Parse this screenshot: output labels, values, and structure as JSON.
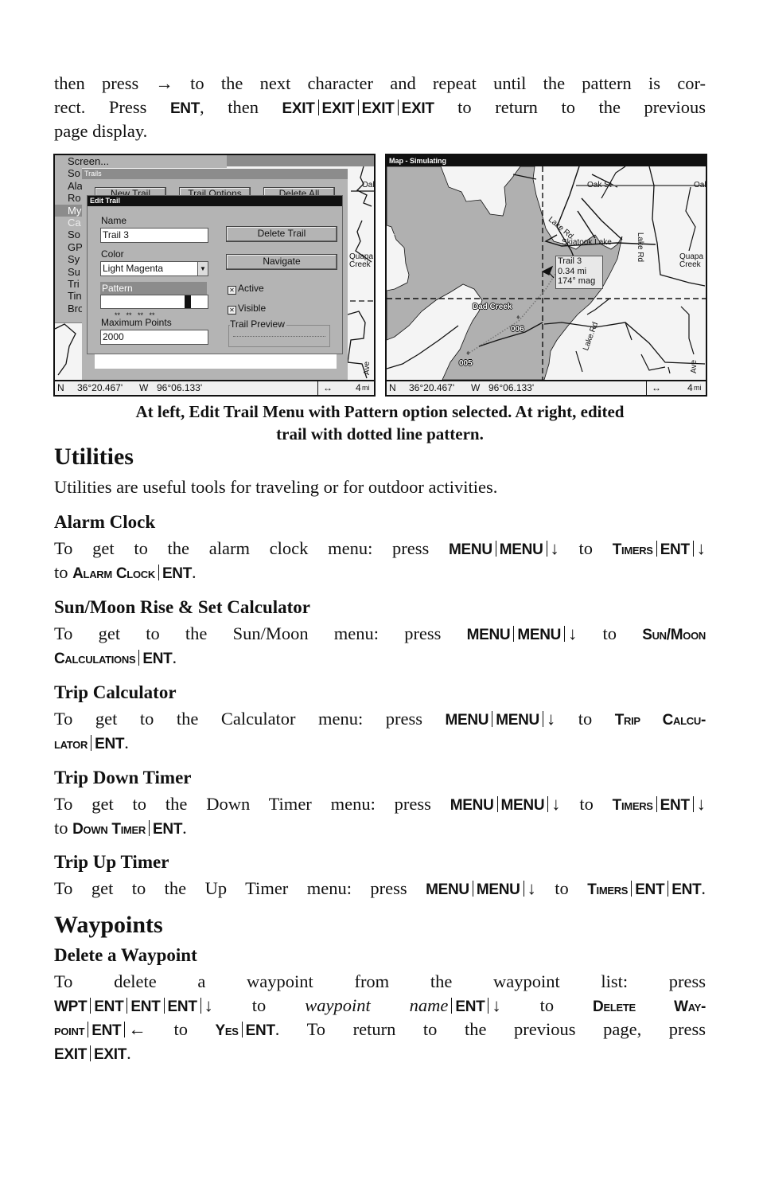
{
  "intro": {
    "line1": "then press → to the next character and repeat until the pattern is cor-",
    "line2_a": "rect. Press",
    "line2_ent": "ENT",
    "line2_b": ", then",
    "exit": "EXIT",
    "line2_c": "to return to the previous",
    "line3": "page display."
  },
  "left_screen": {
    "menu_items": [
      "Screen...",
      "So",
      "Ala",
      "Ro",
      "My",
      "Ca",
      "So",
      "GP",
      "Sy",
      "Su",
      "Tri",
      "Tin",
      "Bro"
    ],
    "selected_menu_index": 4,
    "trails_title": "Trails",
    "trails_buttons": [
      "New Trail",
      "Trail Options",
      "Delete All"
    ],
    "edit_title": "Edit Trail",
    "name_label": "Name",
    "name_value": "Trail 3",
    "color_label": "Color",
    "color_value": "Light Magenta",
    "pattern_label": "Pattern",
    "pattern_value": "**   **   **   **",
    "max_points_label": "Maximum Points",
    "max_points_value": "2000",
    "delete_trail": "Delete Trail",
    "navigate": "Navigate",
    "active_label": "Active",
    "active_checked": true,
    "visible_label": "Visible",
    "visible_checked": true,
    "preview_label": "Trail Preview",
    "map_labels": [
      "Oal",
      "Quapa",
      "Creek",
      "Ave"
    ],
    "status": {
      "lat_hemi": "N",
      "lat": "36°20.467'",
      "lon_hemi": "W",
      "lon": "96°06.133'",
      "zoom_icon": "↔",
      "zoom_value": "4",
      "zoom_unit": "mi"
    }
  },
  "right_screen": {
    "title": "Map - Simulating",
    "labels": {
      "oak_st": "Oak St",
      "oal": "Oal",
      "lake_rd_top": "Lake Rd",
      "skiatook": "Skiatook.Lake",
      "lake_rd_right": "Lake Rd",
      "quapa": "Quapa",
      "creek": "Creek",
      "dad_creek": "Dad Creek",
      "lake_rd_bottom": "Lake.Rd",
      "ave": "Ave"
    },
    "popup": {
      "line1": "Trail 3",
      "line2": "0.34 mi",
      "line3": "174° mag"
    },
    "waypoints": [
      "006",
      "005"
    ],
    "status": {
      "lat_hemi": "N",
      "lat": "36°20.467'",
      "lon_hemi": "W",
      "lon": "96°06.133'",
      "zoom_icon": "↔",
      "zoom_value": "4",
      "zoom_unit": "mi"
    }
  },
  "caption": {
    "line1": "At left, Edit Trail Menu with Pattern option selected. At right, edited",
    "line2": "trail with dotted line pattern."
  },
  "utilities": {
    "heading": "Utilities",
    "intro": "Utilities are useful tools for traveling or for outdoor activities.",
    "keys": {
      "menu": "MENU",
      "ent": "ENT",
      "down": "↓",
      "left": "←",
      "to": "to",
      "wpt": "WPT",
      "exit": "EXIT"
    },
    "alarm": {
      "heading": "Alarm Clock",
      "text": "To get to the alarm clock menu: press",
      "timers": "Timers",
      "target": "Alarm Clock"
    },
    "sunmoon": {
      "heading": "Sun/Moon Rise & Set Calculator",
      "text": "To get to the Sun/Moon menu: press",
      "target_a": "Sun/Moon",
      "target_b": "Calculations"
    },
    "tripcalc": {
      "heading": "Trip Calculator",
      "text": "To get to the Calculator menu: press",
      "target_a": "Trip Calcu-",
      "target_b": "lator"
    },
    "downtimer": {
      "heading": "Trip Down Timer",
      "text": "To get to the Down Timer menu: press",
      "timers": "Timers",
      "target": "Down Timer"
    },
    "uptimer": {
      "heading": "Trip Up Timer",
      "text": "To get to the Up Timer menu: press",
      "timers": "Timers"
    }
  },
  "waypoints": {
    "heading": "Waypoints",
    "delete": {
      "heading": "Delete a Waypoint",
      "text_a": "To delete a waypoint from the waypoint list: press",
      "wp_name": "waypoint name",
      "target_a": "Delete Way-",
      "target_b": "point",
      "yes": "Yes",
      "text_b": "To return to the previous page, press"
    }
  }
}
